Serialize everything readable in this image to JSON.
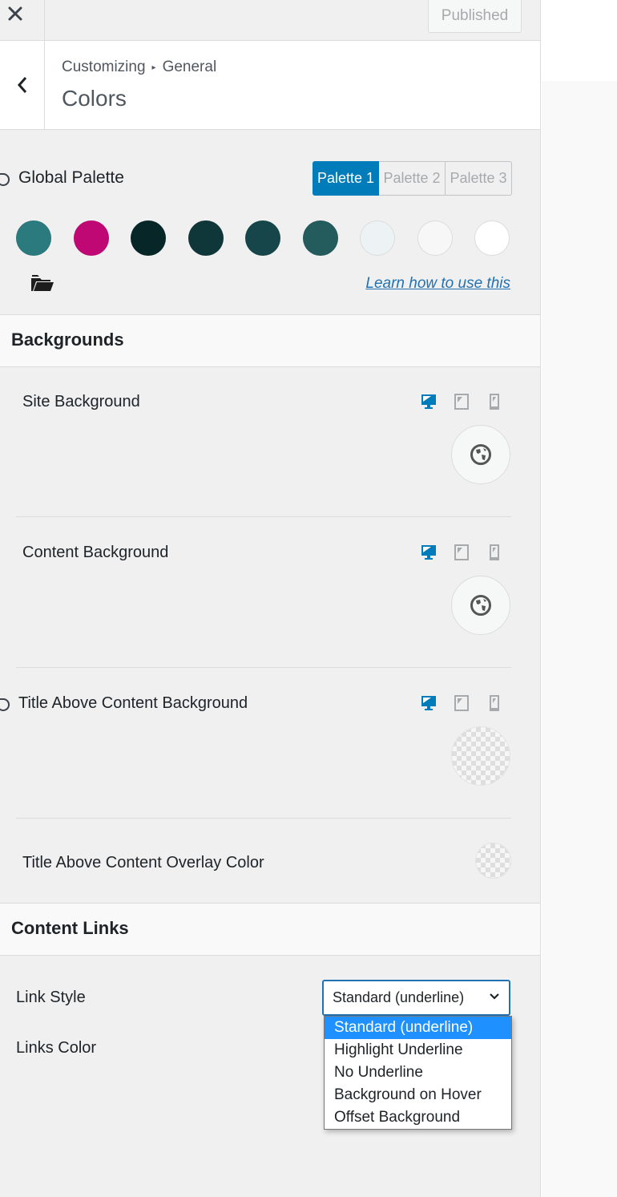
{
  "header": {
    "close_label": "Close",
    "publish_button": "Published"
  },
  "section": {
    "breadcrumb_root": "Customizing",
    "breadcrumb_parent": "General",
    "title": "Colors"
  },
  "global_palette": {
    "label": "Global Palette",
    "tabs": [
      {
        "label": "Palette 1",
        "active": true
      },
      {
        "label": "Palette 2",
        "active": false
      },
      {
        "label": "Palette 3",
        "active": false
      }
    ],
    "swatches": [
      "#2b7a7e",
      "#c00874",
      "#072628",
      "#0f3639",
      "#164649",
      "#245b5d",
      "#edf3f4",
      "#f7f7f7",
      "#ffffff"
    ],
    "learn_link": "Learn how to use this"
  },
  "backgrounds": {
    "heading": "Backgrounds",
    "controls": [
      {
        "label": "Site Background"
      },
      {
        "label": "Content Background"
      },
      {
        "label": "Title Above Content Background"
      },
      {
        "label": "Title Above Content Overlay Color"
      }
    ]
  },
  "content_links": {
    "heading": "Content Links",
    "link_style_label": "Link Style",
    "link_style_value": "Standard (underline)",
    "links_color_label": "Links Color",
    "options": [
      "Standard (underline)",
      "Highlight Underline",
      "No Underline",
      "Background on Hover",
      "Offset Background"
    ],
    "selected_index": 0
  },
  "colors": {
    "accent": "#007cba",
    "link": "#2271b1",
    "dropdown_highlight": "#1e90ff"
  }
}
